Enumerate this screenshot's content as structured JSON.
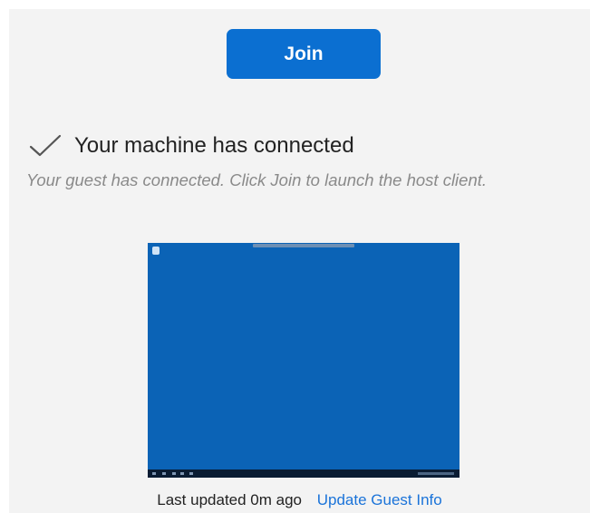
{
  "join_button": {
    "label": "Join",
    "color": "#0b6fd1"
  },
  "status": {
    "icon": "checkmark-icon",
    "title": "Your machine has connected",
    "subtitle": "Your guest has connected. Click Join to launch the host client."
  },
  "preview": {
    "icon": "desktop-preview",
    "background_color": "#0b63b6"
  },
  "footer": {
    "last_updated": "Last updated 0m ago",
    "update_link": "Update Guest Info",
    "link_color": "#1a73d9"
  }
}
